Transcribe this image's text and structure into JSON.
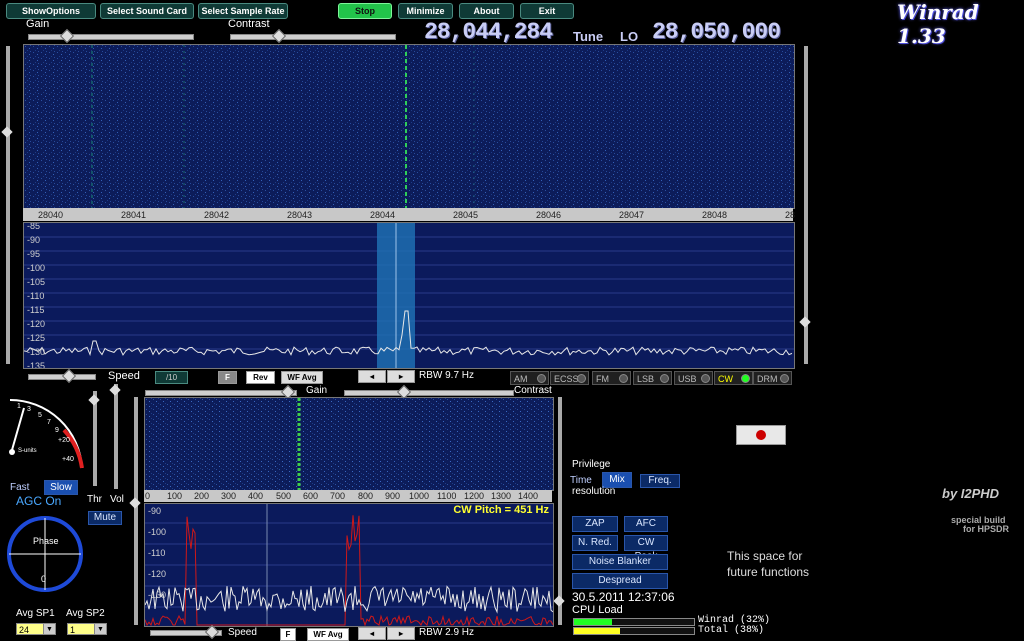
{
  "toolbar": {
    "show_options": "ShowOptions",
    "select_sound_card": "Select Sound Card",
    "select_sample_rate": "Select Sample Rate",
    "stop": "Stop",
    "minimize": "Minimize",
    "about": "About",
    "exit": "Exit"
  },
  "brand": {
    "title": "Winrad 1.33",
    "author": "by I2PHD",
    "special1": "special build",
    "special2": "for HPSDR"
  },
  "top_sliders": {
    "gain": "Gain",
    "contrast": "Contrast"
  },
  "freq": {
    "tune_value": "28,044,284",
    "tune_label": "Tune",
    "lo_label": "LO",
    "lo_value": "28,050,000"
  },
  "main_scale": {
    "ticks": [
      "28040",
      "28041",
      "28042",
      "28043",
      "28044",
      "28045",
      "28046",
      "28047",
      "28048",
      "28"
    ]
  },
  "main_db": [
    "-85",
    "-90",
    "-95",
    "-100",
    "-105",
    "-110",
    "-115",
    "-120",
    "-125",
    "-130",
    "-135"
  ],
  "main_controls": {
    "speed": "Speed",
    "speed_val": "/10",
    "f_btn": "F",
    "rev_btn": "Rev",
    "wfavg_btn": "WF Avg",
    "rbw": "RBW  9.7 Hz"
  },
  "modes": [
    {
      "label": "AM",
      "active": false
    },
    {
      "label": "ECSS",
      "active": false
    },
    {
      "label": "FM",
      "active": false
    },
    {
      "label": "LSB",
      "active": false
    },
    {
      "label": "USB",
      "active": false
    },
    {
      "label": "CW",
      "active": true
    },
    {
      "label": "DRM",
      "active": false
    }
  ],
  "meter": {
    "scale": [
      "1",
      "3",
      "5",
      "7",
      "9",
      "+20",
      "+40"
    ],
    "label": "S-units"
  },
  "agc": {
    "fast": "Fast",
    "slow": "Slow",
    "agc_on": "AGC On",
    "thr": "Thr",
    "vol": "Vol",
    "mute": "Mute"
  },
  "phase": {
    "label": "Phase",
    "zero": "0"
  },
  "avg": {
    "sp1_label": "Avg SP1",
    "sp2_label": "Avg SP2",
    "sp1_val": "24",
    "sp2_val": "1"
  },
  "audio_panel": {
    "gain": "Gain",
    "contrast": "Contrast",
    "scale": [
      "0",
      "100",
      "200",
      "300",
      "400",
      "500",
      "600",
      "700",
      "800",
      "900",
      "1000",
      "1100",
      "1200",
      "1300",
      "1400"
    ],
    "db": [
      "-90",
      "-100",
      "-110",
      "-120",
      "-130"
    ],
    "cw_pitch": "CW Pitch = 451 Hz",
    "speed": "Speed",
    "f_btn": "F",
    "wfavg_btn": "WF Avg",
    "rbw": "RBW  2.9 Hz"
  },
  "privilege": {
    "title": "Privilege",
    "time": "Time",
    "mix": "Mix",
    "freq": "Freq.",
    "resolution": "resolution"
  },
  "dsp": {
    "zap": "ZAP",
    "afc": "AFC",
    "nred": "N. Red.",
    "cwpeak": "CW Peak",
    "nb": "Noise Blanker",
    "despread": "Despread"
  },
  "future": {
    "line1": "This space for",
    "line2": "future functions"
  },
  "status": {
    "datetime": "30.5.2011  12:37:06",
    "cpu_label": "CPU Load",
    "winrad": "Winrad  (32%)",
    "total": "Total   (38%)",
    "winrad_pct": 32,
    "total_pct": 38
  },
  "colors": {
    "accent_green": "#22c34a",
    "panel_blue": "#0b1a5c",
    "trace_white": "#e8e8e8",
    "trace_red": "#d01818"
  }
}
